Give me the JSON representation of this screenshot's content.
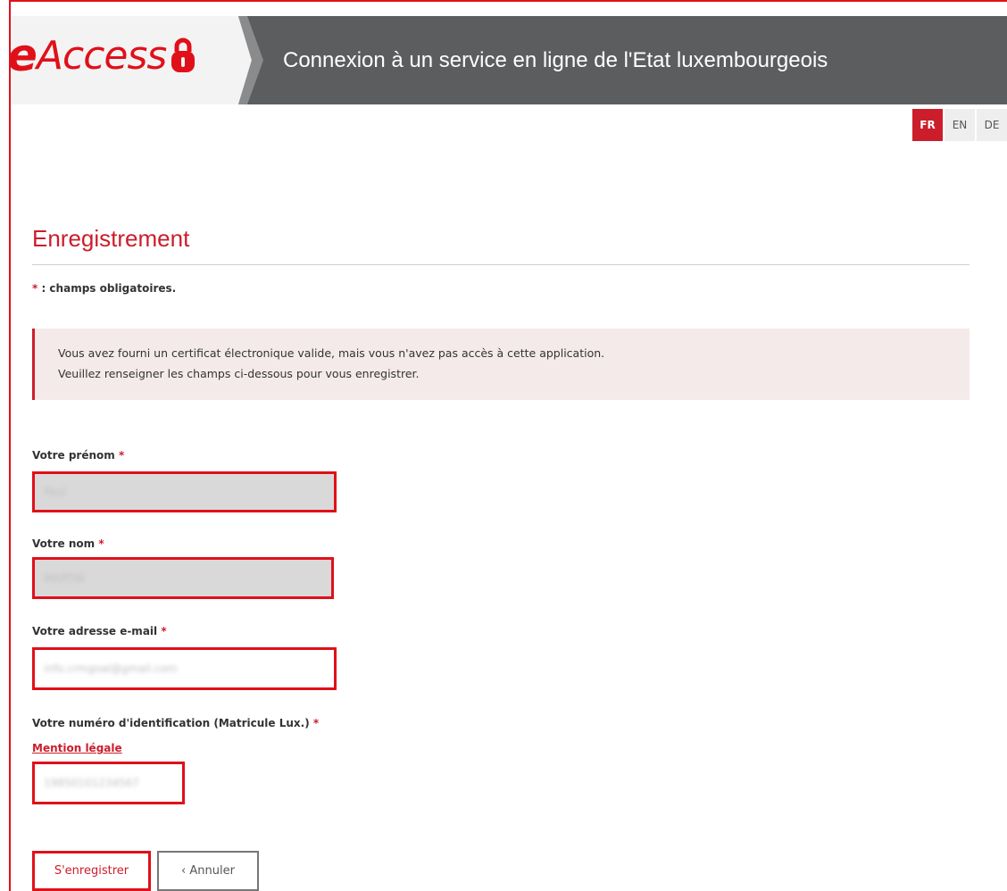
{
  "header": {
    "logo_prefix": "e",
    "logo_text": "Access",
    "title": "Connexion à un service en ligne de l'Etat luxembourgeois"
  },
  "languages": [
    {
      "code": "FR",
      "active": true
    },
    {
      "code": "EN",
      "active": false
    },
    {
      "code": "DE",
      "active": false
    }
  ],
  "page": {
    "title": "Enregistrement",
    "required_star": "*",
    "required_note": " : champs obligatoires."
  },
  "alert": {
    "line1": "Vous avez fourni un certificat électronique valide, mais vous n'avez pas accès à cette application.",
    "line2": "Veuillez renseigner les champs ci-dessous pour vous enregistrer."
  },
  "form": {
    "first_name": {
      "label": "Votre prénom",
      "star": "*",
      "value": "Paul"
    },
    "last_name": {
      "label": "Votre nom",
      "star": "*",
      "value": "MARTIN"
    },
    "email": {
      "label": "Votre adresse e-mail",
      "star": "*",
      "value": "info.crmgoal@gmail.com"
    },
    "id_number": {
      "label": "Votre numéro d'identification (Matricule Lux.)",
      "star": "*",
      "value": "19850101234567",
      "legal_link": "Mention légale"
    }
  },
  "buttons": {
    "register": "S'enregistrer",
    "cancel_icon": "‹",
    "cancel": "Annuler"
  },
  "colors": {
    "brand_red": "#cc1d2b",
    "highlight_red": "#e0101a",
    "header_bg": "#5c5d5f",
    "alert_bg": "#f5eaea"
  }
}
